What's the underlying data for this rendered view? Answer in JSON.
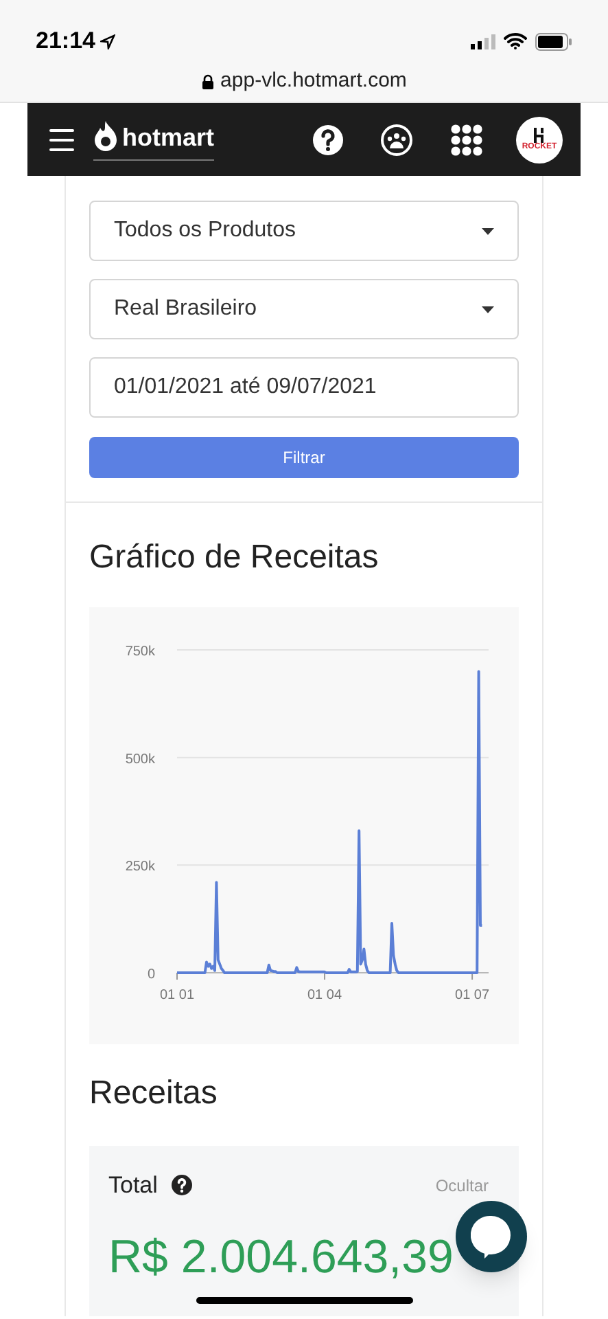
{
  "status_bar": {
    "time": "21:14"
  },
  "browser": {
    "url": "app-vlc.hotmart.com"
  },
  "nav": {
    "brand": "hotmart",
    "avatar_label": "ROCKET"
  },
  "filters": {
    "product": "Todos os Produtos",
    "currency": "Real Brasileiro",
    "date_range": "01/01/2021 até 09/07/2021",
    "button": "Filtrar"
  },
  "chart_section": {
    "title": "Gráfico de Receitas",
    "chart_data": {
      "type": "line",
      "categories": [
        "01 01",
        null,
        null,
        null,
        null,
        null,
        null,
        null,
        null,
        null,
        null,
        null,
        null,
        null,
        null,
        null,
        null,
        null,
        null,
        null,
        null,
        null,
        null,
        null,
        null,
        null,
        null,
        null,
        null,
        null,
        null,
        null,
        null,
        null,
        null,
        null,
        null,
        null,
        null,
        null,
        null,
        null,
        null,
        null,
        null,
        null,
        null,
        null,
        null,
        null,
        null,
        null,
        null,
        null,
        null,
        null,
        null,
        null,
        null,
        null,
        null,
        null,
        null,
        null,
        null,
        null,
        null,
        null,
        null,
        null,
        null,
        null,
        null,
        null,
        null,
        null,
        null,
        null,
        null,
        null,
        null,
        null,
        null,
        null,
        null,
        null,
        null,
        null,
        null,
        null,
        "01 04",
        null,
        null,
        null,
        null,
        null,
        null,
        null,
        null,
        null,
        null,
        null,
        null,
        null,
        null,
        null,
        null,
        null,
        null,
        null,
        null,
        null,
        null,
        null,
        null,
        null,
        null,
        null,
        null,
        null,
        null,
        null,
        null,
        null,
        null,
        null,
        null,
        null,
        null,
        null,
        null,
        null,
        null,
        null,
        null,
        null,
        null,
        null,
        null,
        null,
        null,
        null,
        null,
        null,
        null,
        null,
        null,
        null,
        null,
        null,
        null,
        null,
        null,
        null,
        null,
        null,
        null,
        null,
        null,
        null,
        null,
        null,
        null,
        null,
        null,
        null,
        null,
        null,
        null,
        null,
        null,
        null,
        null,
        null,
        null,
        null,
        null,
        null,
        null,
        null,
        "01 07",
        null,
        null,
        null,
        null,
        null,
        null
      ],
      "series": [
        {
          "color": "#5b7fd6",
          "values": [
            0,
            0,
            0,
            0,
            0,
            0,
            0,
            0,
            0,
            0,
            0,
            0,
            0,
            0,
            0,
            0,
            0,
            0,
            25,
            15,
            20,
            10,
            15,
            5,
            210,
            30,
            20,
            10,
            5,
            0,
            0,
            0,
            0,
            0,
            0,
            0,
            0,
            0,
            0,
            0,
            0,
            0,
            0,
            0,
            0,
            0,
            0,
            0,
            0,
            0,
            0,
            0,
            0,
            0,
            0,
            0,
            18,
            5,
            4,
            3,
            3,
            0,
            0,
            0,
            0,
            0,
            0,
            0,
            0,
            0,
            0,
            0,
            0,
            12,
            3,
            2,
            2,
            2,
            2,
            2,
            2,
            2,
            2,
            2,
            2,
            2,
            2,
            2,
            2,
            2,
            2,
            0,
            0,
            0,
            0,
            0,
            0,
            0,
            0,
            0,
            0,
            0,
            0,
            0,
            0,
            8,
            2,
            2,
            2,
            2,
            3,
            330,
            20,
            30,
            55,
            20,
            5,
            0,
            0,
            0,
            0,
            0,
            0,
            0,
            0,
            0,
            0,
            0,
            0,
            0,
            0,
            115,
            40,
            20,
            5,
            0,
            0,
            0,
            0,
            0,
            0,
            0,
            0,
            0,
            0,
            0,
            0,
            0,
            0,
            0,
            0,
            0,
            0,
            0,
            0,
            0,
            0,
            0,
            0,
            0,
            0,
            0,
            0,
            0,
            0,
            0,
            0,
            0,
            0,
            0,
            0,
            0,
            0,
            0,
            0,
            0,
            0,
            0,
            0,
            0,
            0,
            0,
            0,
            0,
            700,
            110,
            110
          ]
        }
      ],
      "ylim": [
        0,
        750
      ],
      "yticks": [
        {
          "value": 0,
          "label": "0"
        },
        {
          "value": 250,
          "label": "250k"
        },
        {
          "value": 500,
          "label": "500k"
        },
        {
          "value": 750,
          "label": "750k"
        }
      ]
    }
  },
  "revenue": {
    "title": "Receitas",
    "total_label": "Total",
    "hide_link": "Ocultar",
    "amount": "R$ 2.004.643,39"
  }
}
